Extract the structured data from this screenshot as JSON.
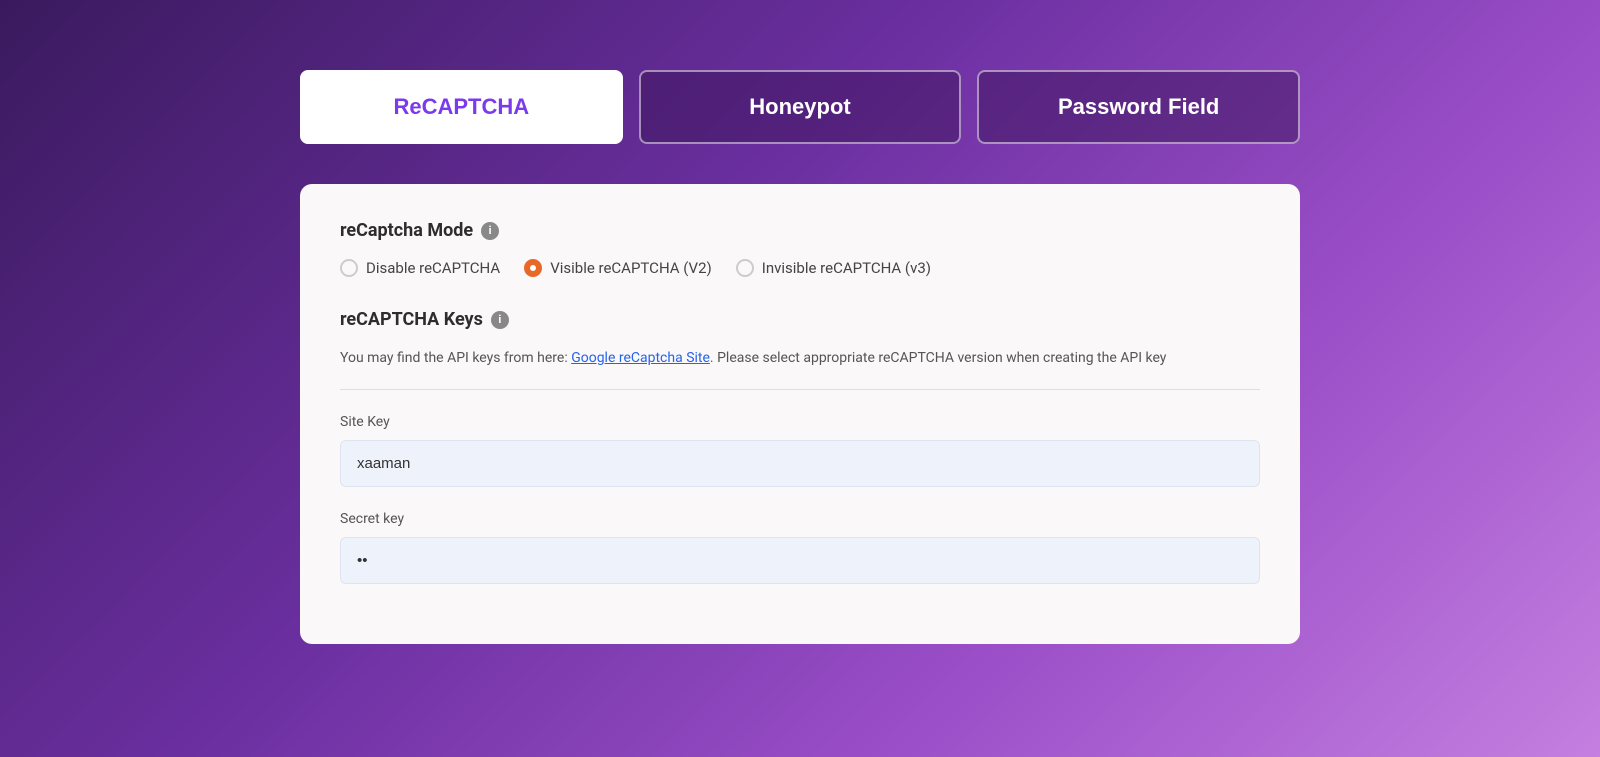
{
  "tabs": [
    {
      "id": "recaptcha",
      "label": "ReCAPTCHA",
      "active": true
    },
    {
      "id": "honeypot",
      "label": "Honeypot",
      "active": false
    },
    {
      "id": "password-field",
      "label": "Password Field",
      "active": false
    }
  ],
  "panel": {
    "recaptcha_mode_section": {
      "title": "reCaptcha Mode",
      "info_icon": "i",
      "radio_options": [
        {
          "id": "disable",
          "label": "Disable reCAPTCHA",
          "checked": false
        },
        {
          "id": "visible",
          "label": "Visible reCAPTCHA (V2)",
          "checked": true
        },
        {
          "id": "invisible",
          "label": "Invisible reCAPTCHA (v3)",
          "checked": false
        }
      ]
    },
    "recaptcha_keys_section": {
      "title": "reCAPTCHA Keys",
      "info_icon": "i",
      "description_prefix": "You may find the API keys from here: ",
      "description_link_text": "Google reCaptcha Site",
      "description_link_url": "#",
      "description_suffix": ". Please select appropriate reCAPTCHA version when creating the API key",
      "site_key_label": "Site Key",
      "site_key_value": "xaaman",
      "secret_key_label": "Secret key",
      "secret_key_value": "••"
    }
  }
}
